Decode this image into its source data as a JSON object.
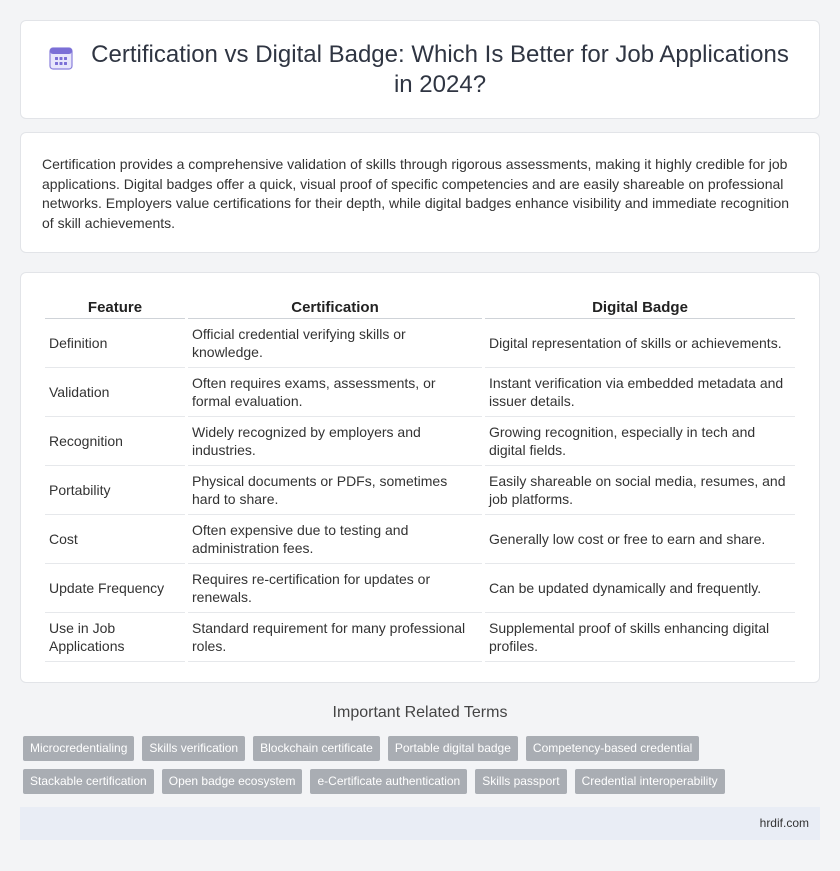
{
  "header": {
    "title": "Certification vs Digital Badge: Which Is Better for Job Applications in 2024?",
    "icon": "calendar-icon"
  },
  "summary": {
    "text": "Certification provides a comprehensive validation of skills through rigorous assessments, making it highly credible for job applications. Digital badges offer a quick, visual proof of specific competencies and are easily shareable on professional networks. Employers value certifications for their depth, while digital badges enhance visibility and immediate recognition of skill achievements."
  },
  "table": {
    "headers": [
      "Feature",
      "Certification",
      "Digital Badge"
    ],
    "rows": [
      [
        "Definition",
        "Official credential verifying skills or knowledge.",
        "Digital representation of skills or achievements."
      ],
      [
        "Validation",
        "Often requires exams, assessments, or formal evaluation.",
        "Instant verification via embedded metadata and issuer details."
      ],
      [
        "Recognition",
        "Widely recognized by employers and industries.",
        "Growing recognition, especially in tech and digital fields."
      ],
      [
        "Portability",
        "Physical documents or PDFs, sometimes hard to share.",
        "Easily shareable on social media, resumes, and job platforms."
      ],
      [
        "Cost",
        "Often expensive due to testing and administration fees.",
        "Generally low cost or free to earn and share."
      ],
      [
        "Update Frequency",
        "Requires re-certification for updates or renewals.",
        "Can be updated dynamically and frequently."
      ],
      [
        "Use in Job Applications",
        "Standard requirement for many professional roles.",
        "Supplemental proof of skills enhancing digital profiles."
      ]
    ]
  },
  "related": {
    "title": "Important Related Terms",
    "tags": [
      "Microcredentialing",
      "Skills verification",
      "Blockchain certificate",
      "Portable digital badge",
      "Competency-based credential",
      "Stackable certification",
      "Open badge ecosystem",
      "e-Certificate authentication",
      "Skills passport",
      "Credential interoperability"
    ]
  },
  "footer": {
    "site": "hrdif.com"
  },
  "colors": {
    "background": "#f3f4f6",
    "tag": "#a9adb3",
    "footer": "#e9edf5",
    "icon_accent": "#7b6fd6"
  }
}
